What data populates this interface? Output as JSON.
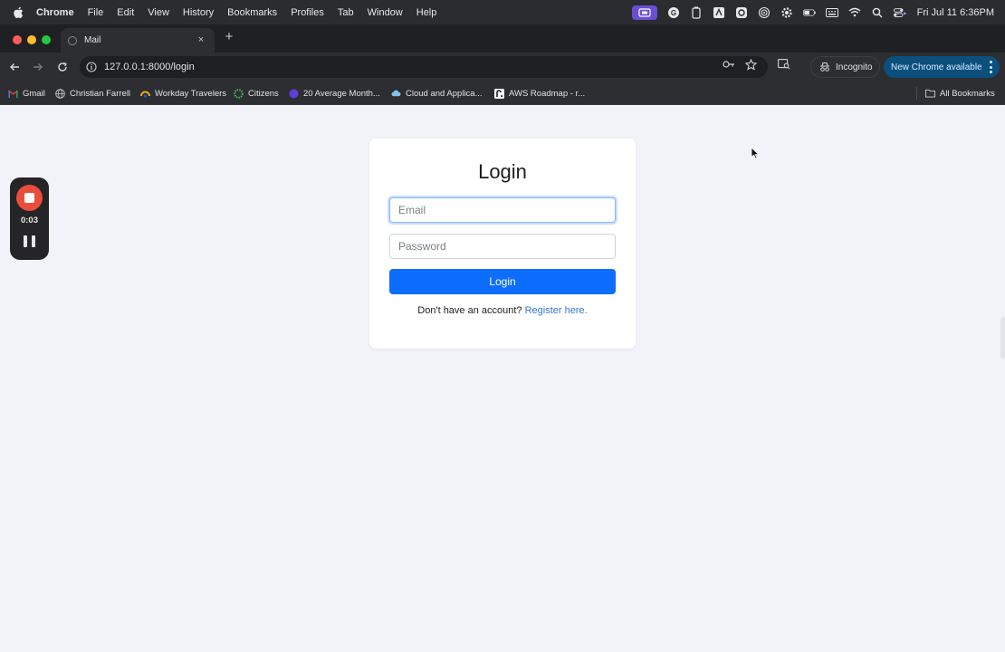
{
  "menubar": {
    "app_name": "Chrome",
    "items": [
      "File",
      "Edit",
      "View",
      "History",
      "Bookmarks",
      "Profiles",
      "Tab",
      "Window",
      "Help"
    ],
    "clock": "Fri Jul 11  6:36PM"
  },
  "tab": {
    "title": "Mail",
    "close": "×",
    "new_tab": "+"
  },
  "toolbar": {
    "url": "127.0.0.1:8000/login",
    "incognito_label": "Incognito",
    "update_label": "New Chrome available"
  },
  "bookmarks": {
    "items": [
      {
        "label": "Gmail",
        "icon": "gmail-icon",
        "color": "#ea4335"
      },
      {
        "label": "Christian Farrell",
        "icon": "globe-icon",
        "color": "#bdbdbd"
      },
      {
        "label": "Workday Travelers",
        "icon": "workday-icon",
        "color": "#f5a623"
      },
      {
        "label": "Citizens",
        "icon": "citizens-icon",
        "color": "#3fb34f"
      },
      {
        "label": "20 Average Month...",
        "icon": "circle-icon",
        "color": "#5b3fd6"
      },
      {
        "label": "Cloud and Applica...",
        "icon": "cloud-icon",
        "color": "#7fc4e8"
      },
      {
        "label": "AWS Roadmap - r...",
        "icon": "aws-icon",
        "color": "#ffffff"
      }
    ],
    "all_bookmarks": "All Bookmarks"
  },
  "login": {
    "title": "Login",
    "email_placeholder": "Email",
    "password_placeholder": "Password",
    "submit_label": "Login",
    "register_prompt": "Don't have an account?",
    "register_link": "Register here."
  },
  "recorder": {
    "elapsed": "0:03"
  },
  "colors": {
    "primary": "#0d6efd",
    "link": "#3478d4",
    "page_bg": "#f2f3f8",
    "record_red": "#e94e3c"
  }
}
